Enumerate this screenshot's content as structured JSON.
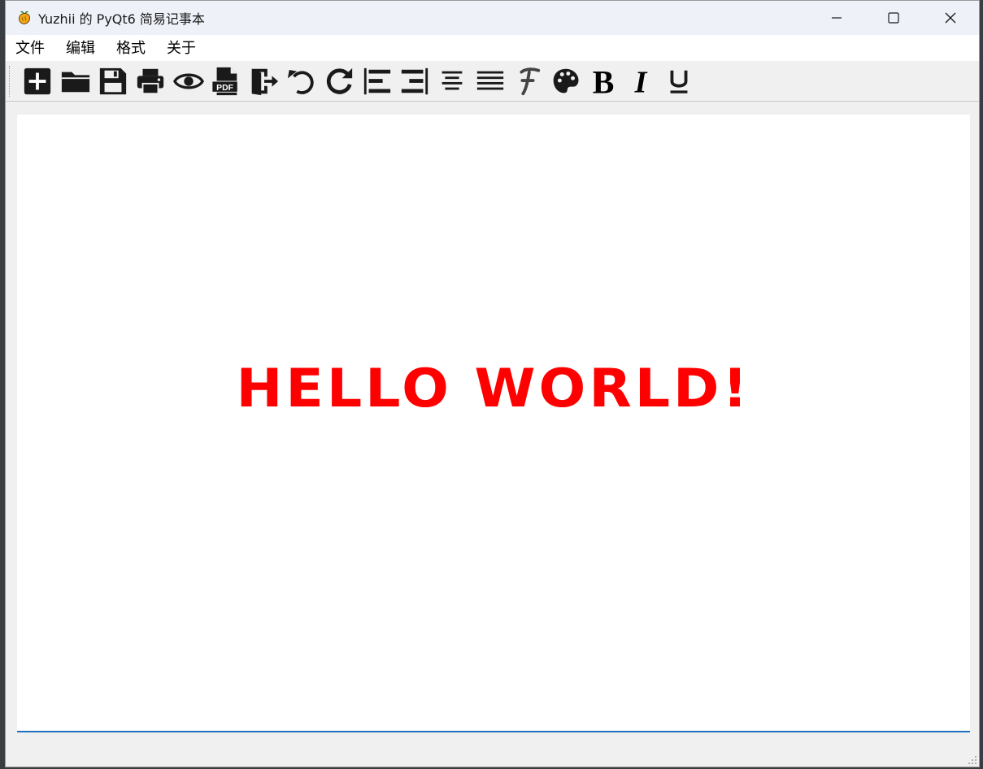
{
  "window": {
    "title": "Yuzhii 的 PyQt6 简易记事本",
    "minimize_label": "minimize",
    "maximize_label": "maximize",
    "close_label": "close"
  },
  "menubar": {
    "items": [
      {
        "label": "文件"
      },
      {
        "label": "编辑"
      },
      {
        "label": "格式"
      },
      {
        "label": "关于"
      }
    ]
  },
  "toolbar": {
    "buttons": [
      {
        "icon": "new-file-icon"
      },
      {
        "icon": "open-folder-icon"
      },
      {
        "icon": "save-icon"
      },
      {
        "icon": "print-icon"
      },
      {
        "icon": "preview-eye-icon"
      },
      {
        "icon": "export-pdf-icon",
        "icon_text": "PDF"
      },
      {
        "icon": "exit-door-icon"
      },
      {
        "icon": "undo-icon"
      },
      {
        "icon": "redo-icon"
      },
      {
        "icon": "align-left-icon"
      },
      {
        "icon": "align-right-icon"
      },
      {
        "icon": "align-center-icon"
      },
      {
        "icon": "align-justify-icon"
      },
      {
        "icon": "font-icon"
      },
      {
        "icon": "color-palette-icon"
      },
      {
        "icon": "bold-icon",
        "icon_text": "B"
      },
      {
        "icon": "italic-icon",
        "icon_text": "I"
      },
      {
        "icon": "underline-icon"
      }
    ]
  },
  "editor": {
    "content": "HELLO WORLD!",
    "text_color": "#ff0000",
    "focus_color": "#1f6fc0"
  }
}
